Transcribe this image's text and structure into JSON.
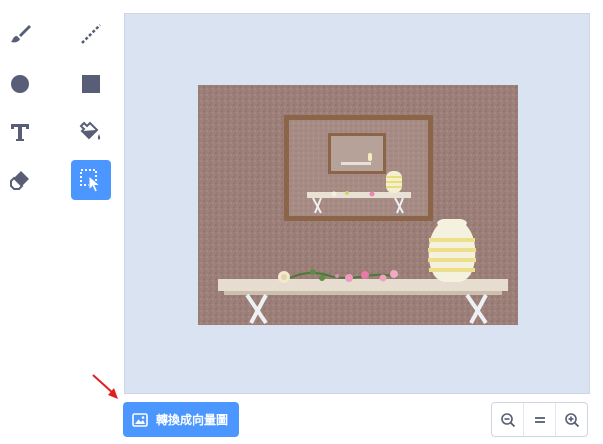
{
  "tools": [
    {
      "name": "brush-tool",
      "icon": "brush-icon",
      "selected": false
    },
    {
      "name": "line-tool",
      "icon": "line-icon",
      "selected": false
    },
    {
      "name": "circle-tool",
      "icon": "circle-icon",
      "selected": false
    },
    {
      "name": "rectangle-tool",
      "icon": "rectangle-icon",
      "selected": false
    },
    {
      "name": "text-tool",
      "icon": "text-icon",
      "selected": false
    },
    {
      "name": "fill-tool",
      "icon": "fill-bucket-icon",
      "selected": false
    },
    {
      "name": "eraser-tool",
      "icon": "eraser-icon",
      "selected": false
    },
    {
      "name": "select-tool",
      "icon": "select-icon",
      "selected": true
    }
  ],
  "convert_button": {
    "label": "轉換成向量圖",
    "icon": "image-icon"
  },
  "zoom": {
    "zoom_out_icon": "zoom-out-icon",
    "reset_icon": "zoom-reset-icon",
    "zoom_in_icon": "zoom-in-icon"
  },
  "colors": {
    "accent": "#4c97ff",
    "icon": "#575e75",
    "stage_bg": "#d9e3f2",
    "annotation_arrow": "#e02020"
  }
}
